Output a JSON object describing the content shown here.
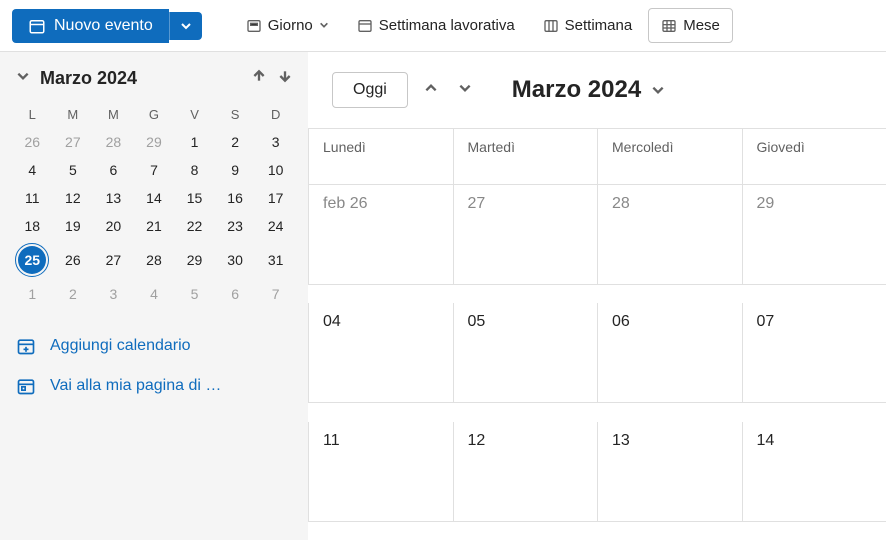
{
  "toolbar": {
    "new_event": "Nuovo evento",
    "views": {
      "day": "Giorno",
      "workweek": "Settimana lavorativa",
      "week": "Settimana",
      "month": "Mese"
    }
  },
  "sidebar": {
    "mini_title": "Marzo 2024",
    "dow": [
      "L",
      "M",
      "M",
      "G",
      "V",
      "S",
      "D"
    ],
    "weeks": [
      [
        {
          "d": "26",
          "o": true
        },
        {
          "d": "27",
          "o": true
        },
        {
          "d": "28",
          "o": true
        },
        {
          "d": "29",
          "o": true
        },
        {
          "d": "1"
        },
        {
          "d": "2"
        },
        {
          "d": "3"
        }
      ],
      [
        {
          "d": "4"
        },
        {
          "d": "5"
        },
        {
          "d": "6"
        },
        {
          "d": "7"
        },
        {
          "d": "8"
        },
        {
          "d": "9"
        },
        {
          "d": "10"
        }
      ],
      [
        {
          "d": "11"
        },
        {
          "d": "12"
        },
        {
          "d": "13"
        },
        {
          "d": "14"
        },
        {
          "d": "15"
        },
        {
          "d": "16"
        },
        {
          "d": "17"
        }
      ],
      [
        {
          "d": "18"
        },
        {
          "d": "19"
        },
        {
          "d": "20"
        },
        {
          "d": "21"
        },
        {
          "d": "22"
        },
        {
          "d": "23"
        },
        {
          "d": "24"
        }
      ],
      [
        {
          "d": "25",
          "t": true
        },
        {
          "d": "26"
        },
        {
          "d": "27"
        },
        {
          "d": "28"
        },
        {
          "d": "29"
        },
        {
          "d": "30"
        },
        {
          "d": "31"
        }
      ],
      [
        {
          "d": "1",
          "o": true
        },
        {
          "d": "2",
          "o": true
        },
        {
          "d": "3",
          "o": true
        },
        {
          "d": "4",
          "o": true
        },
        {
          "d": "5",
          "o": true
        },
        {
          "d": "6",
          "o": true
        },
        {
          "d": "7",
          "o": true
        }
      ]
    ],
    "add_calendar": "Aggiungi calendario",
    "goto_page": "Vai alla mia pagina di …"
  },
  "calendar": {
    "today_btn": "Oggi",
    "title": "Marzo 2024",
    "day_headers": [
      "Lunedì",
      "Martedì",
      "Mercoledì",
      "Giovedì"
    ],
    "rows": [
      [
        "feb 26",
        "27",
        "28",
        "29"
      ],
      [
        "04",
        "05",
        "06",
        "07"
      ],
      [
        "11",
        "12",
        "13",
        "14"
      ]
    ]
  }
}
